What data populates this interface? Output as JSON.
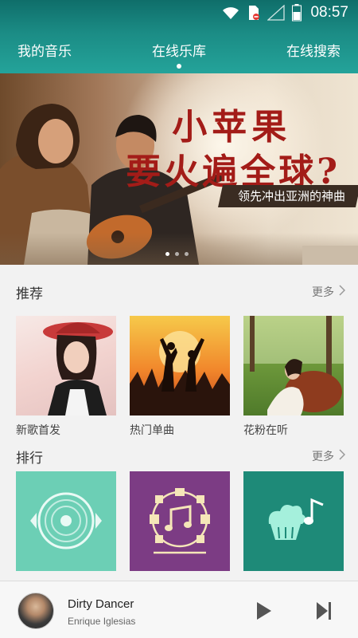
{
  "status": {
    "time": "08:57"
  },
  "nav": {
    "tabs": [
      {
        "label": "我的音乐"
      },
      {
        "label": "在线乐库",
        "active": true
      },
      {
        "label": "在线搜索"
      }
    ]
  },
  "banner": {
    "title_line1": "小苹果",
    "title_line2": "要火遍全球?",
    "subtitle": "领先冲出亚洲的神曲"
  },
  "recommend": {
    "title": "推荐",
    "more": "更多",
    "items": [
      {
        "label": "新歌首发"
      },
      {
        "label": "热门单曲"
      },
      {
        "label": "花粉在听"
      }
    ]
  },
  "ranking": {
    "title": "排行",
    "more": "更多",
    "items": [
      {
        "label": "",
        "icon": "disc-icon"
      },
      {
        "label": "",
        "icon": "music-notes-icon"
      },
      {
        "label": "",
        "icon": "cupcake-note-icon"
      }
    ]
  },
  "player": {
    "song": "Dirty Dancer",
    "artist": "Enrique Iglesias"
  },
  "colors": {
    "accent": "#1b8c85",
    "banner_text": "#a31c18"
  }
}
